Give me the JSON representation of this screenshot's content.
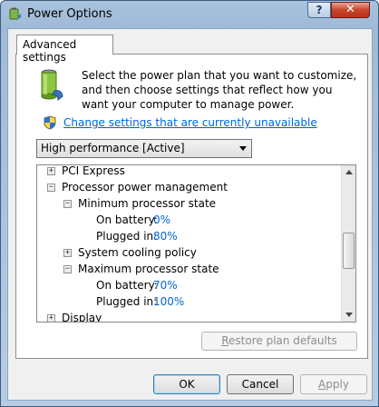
{
  "window": {
    "title": "Power Options",
    "help_label": "?",
    "close_label": "✕"
  },
  "tab": {
    "label": "Advanced settings"
  },
  "intro_text": "Select the power plan that you want to customize, and then choose settings that reflect how you want your computer to manage power.",
  "change_link": "Change settings that are currently unavailable",
  "plan_select": {
    "value": "High performance [Active]"
  },
  "tree": {
    "pci_express": "PCI Express",
    "processor_power": "Processor power management",
    "min_state": "Minimum processor state",
    "min_on_battery_label": "On battery:",
    "min_on_battery_value": "0%",
    "min_plugged_label": "Plugged in:",
    "min_plugged_value": "80%",
    "cooling_policy": "System cooling policy",
    "max_state": "Maximum processor state",
    "max_on_battery_label": "On battery:",
    "max_on_battery_value": "70%",
    "max_plugged_label": "Plugged in:",
    "max_plugged_value": "100%",
    "display": "Display",
    "expand_glyph": "+",
    "collapse_glyph": "−"
  },
  "buttons": {
    "restore_prefix": "R",
    "restore_rest": "estore plan defaults",
    "ok": "OK",
    "cancel": "Cancel",
    "apply_prefix": "A",
    "apply_rest": "pply"
  },
  "colors": {
    "link": "#0066cc",
    "value": "#0066cc"
  }
}
